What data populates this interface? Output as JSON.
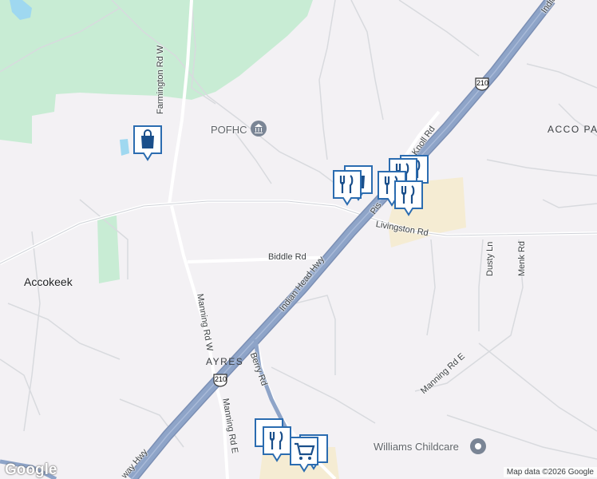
{
  "map": {
    "colors": {
      "background": "#f3f1f4",
      "park": "#c8ecd4",
      "highway": "#8ea4c8",
      "highway_edge": "#7b8fb4",
      "road": "#ffffff",
      "road_edge": "#d6d8de",
      "water": "#9fd8f0",
      "commercial": "#f5ecd3",
      "pin_fill": "#ffffff",
      "pin_icon": "#1a4f8b",
      "pin_border": "#2b6cb0"
    },
    "places": {
      "accokeek": "Accokeek",
      "ayres": "AYRES",
      "acco_park": "ACCO PA"
    },
    "roads": {
      "farmington_rd_w": "Farmington Rd W",
      "biddle_rd": "Biddle Rd",
      "indian_head_hwy": "Indian Head Hwy",
      "livingston_rd": "Livingston Rd",
      "knoll_rd": "Knoll Rd",
      "pis": "Pis",
      "manning_rd_w": "Manning Rd W",
      "berry_rd": "Berry Rd",
      "manning_rd_e_lower": "Manning Rd E",
      "manning_rd_e": "Manning Rd E",
      "dusty_ln": "Dusty Ln",
      "menk_rd": "Menk Rd",
      "way_hwy": "way Hwy",
      "indian_top": "Indian"
    },
    "shields": {
      "route_210_top": "210",
      "route_210_bottom": "210"
    },
    "pois": {
      "pofhc": "POFHC",
      "williams_childcare": "Williams Childcare"
    },
    "pins": [
      {
        "icon": "shopping-bag-icon",
        "name": "shopping"
      },
      {
        "icon": "restaurant-icon",
        "name": "restaurant"
      },
      {
        "icon": "shopping-bag-icon",
        "name": "shopping"
      },
      {
        "icon": "restaurant-icon",
        "name": "restaurant"
      },
      {
        "icon": "restaurant-icon",
        "name": "restaurant"
      },
      {
        "icon": "restaurant-icon",
        "name": "restaurant"
      },
      {
        "icon": "restaurant-icon",
        "name": "restaurant"
      },
      {
        "icon": "grocery-cart-icon",
        "name": "grocery"
      },
      {
        "icon": "restaurant-icon",
        "name": "restaurant"
      },
      {
        "icon": "grocery-cart-icon",
        "name": "grocery"
      }
    ],
    "attribution": "Map data ©2026 Google",
    "logo": "Google"
  }
}
